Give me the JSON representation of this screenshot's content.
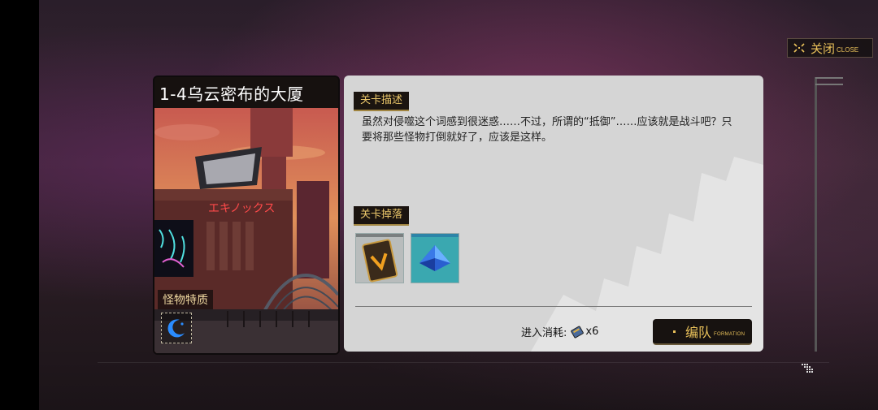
{
  "header": {
    "close_label": "关闭",
    "close_label_en": "CLOSE"
  },
  "stage": {
    "title": "1-4乌云密布的大厦",
    "sign_text": "エキノックス",
    "monster_trait_label": "怪物特质",
    "monster_trait_icon": "moon-icon"
  },
  "details": {
    "description_tag": "关卡描述",
    "description_text": "虽然对侵噬这个词感到很迷惑……不过，所谓的“抵御”……应该就是战斗吧？只要将那些怪物打倒就好了，应该是这样。",
    "drops_tag": "关卡掉落",
    "drops": [
      {
        "icon": "v-card-icon",
        "accent": "#7a7f80"
      },
      {
        "icon": "blue-crystal-icon",
        "accent": "#2c84a8"
      }
    ],
    "cost_label": "进入消耗:",
    "cost_icon": "ticket-icon",
    "cost_value": "x6",
    "formation_label": "编队",
    "formation_label_en": "FORMATION"
  },
  "colors": {
    "accent_gold": "#e9c15a",
    "panel_bg": "#d5d5d5"
  }
}
